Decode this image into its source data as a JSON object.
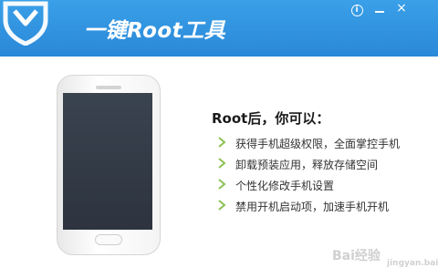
{
  "header": {
    "title": "一键Root工具",
    "info_button": "i",
    "minimize_button": "",
    "close_button": "×"
  },
  "main": {
    "heading": "Root后，你可以：",
    "features": [
      "获得手机超级权限，全面掌控手机",
      "卸载预装应用，释放存储空间",
      "个性化修改手机设置",
      "禁用开机启动项，加速手机开机"
    ]
  },
  "watermark": {
    "text": "Bai经验",
    "sub": "jingyan.baidu.com"
  },
  "colors": {
    "header_top": "#3aa0e8",
    "header_bottom": "#2a88d8",
    "chevron": "#8cc152",
    "screen": "#343c48"
  },
  "icons": [
    "shield-logo-icon",
    "info-icon",
    "minimize-icon",
    "close-icon",
    "chevron-right-icon",
    "phone-illustration"
  ]
}
